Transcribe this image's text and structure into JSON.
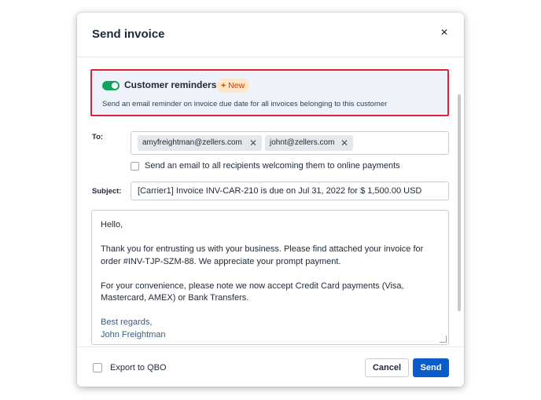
{
  "dialog": {
    "title": "Send invoice",
    "close_glyph": "×"
  },
  "reminders": {
    "title": "Customer reminders",
    "enabled": true,
    "badge": "New",
    "badge_icon": "sparkle-icon",
    "description": "Send an email reminder on invoice due date for all invoices belonging to this customer"
  },
  "to": {
    "label": "To:",
    "recipients": [
      "amyfreightman@zellers.com",
      "johnt@zellers.com"
    ],
    "remove_glyph": "✕"
  },
  "welcome_checkbox": {
    "label": "Send an email to all recipients welcoming them to online payments",
    "checked": false
  },
  "subject": {
    "label": "Subject:",
    "value": "[Carrier1] Invoice INV-CAR-210 is due on Jul 31, 2022 for $ 1,500.00 USD"
  },
  "message": {
    "greeting": "Hello,",
    "paragraph1": "Thank you for entrusting us with your business. Please find attached your invoice for order #INV-TJP-SZM-88. We appreciate your prompt payment.",
    "paragraph2": "For your convenience, please note we now accept Credit Card payments (Visa, Mastercard, AMEX) or Bank Transfers.",
    "signoff": "Best regards,",
    "signature": "John Freightman"
  },
  "footer": {
    "export_label": "Export to QBO",
    "export_checked": false,
    "cancel_label": "Cancel",
    "send_label": "Send"
  },
  "colors": {
    "toggle_on": "#12a35e",
    "highlight_border": "#e0222c",
    "primary": "#0b5cc9",
    "badge_bg": "#fde7c8",
    "badge_text": "#c2410c"
  }
}
